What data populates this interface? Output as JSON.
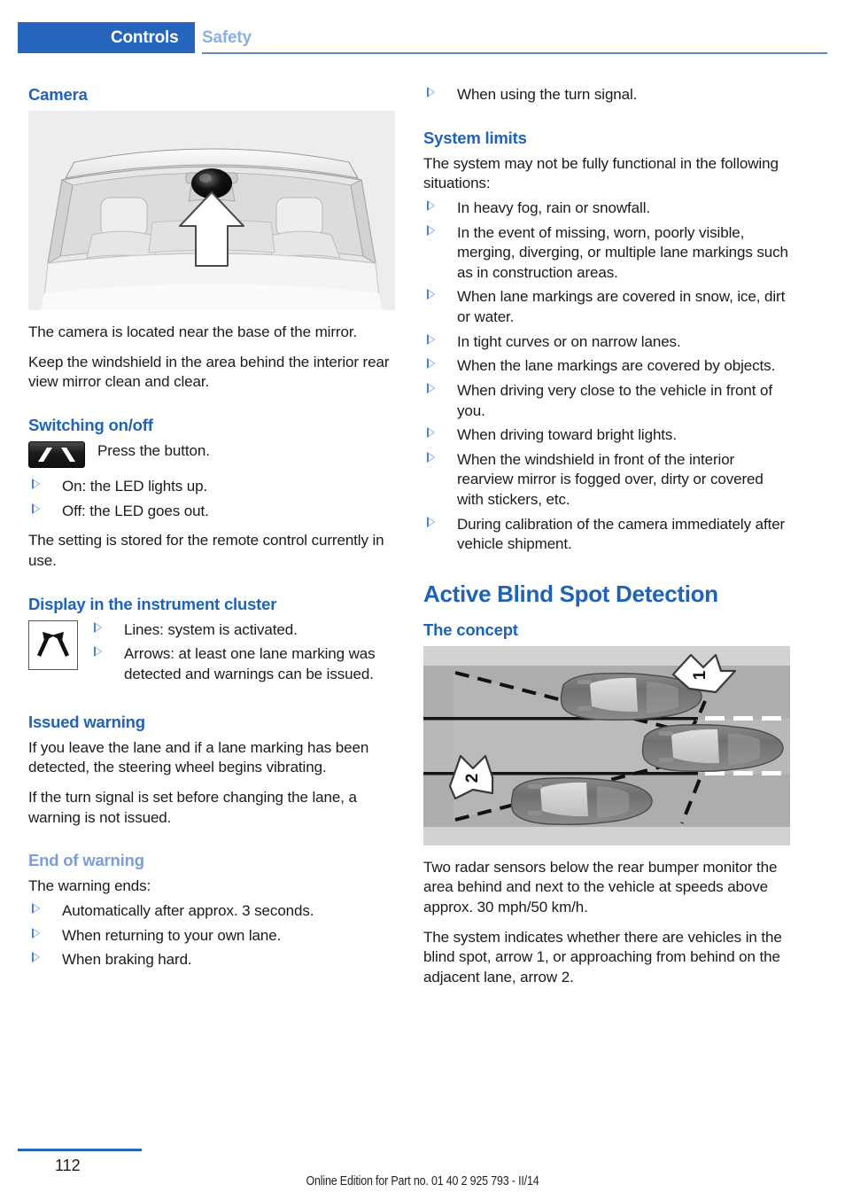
{
  "header": {
    "active_tab": "Controls",
    "inactive_tab": "Safety",
    "accent_color": "#2665BE",
    "inactive_color": "#8FAEE0"
  },
  "left_column": {
    "camera_heading": "Camera",
    "camera_figure_name": "camera-location-illustration",
    "camera_p1": "The camera is located near the base of the mirror.",
    "camera_p2": "Keep the windshield in the area behind the interior rear view mirror clean and clear.",
    "switching_heading": "Switching on/off",
    "switching_icon_text": "Press the button.",
    "switching_bullets": [
      "On: the LED lights up.",
      "Off: the LED goes out."
    ],
    "switching_p1": "The setting is stored for the remote control currently in use.",
    "cluster_heading": "Display in the instrument cluster",
    "cluster_bullets": [
      "Lines: system is activated.",
      "Arrows: at least one lane marking was detected and warnings can be issued."
    ],
    "issued_heading": "Issued warning",
    "issued_p1": "If you leave the lane and if a lane marking has been detected, the steering wheel begins vibrating.",
    "issued_p2": "If the turn signal is set before changing the lane, a warning is not issued.",
    "end_heading": "End of warning",
    "end_p1": "The warning ends:",
    "end_bullets": [
      "Automatically after approx. 3 seconds.",
      "When returning to your own lane.",
      "When braking hard."
    ]
  },
  "right_column": {
    "top_bullet": "When using the turn signal.",
    "limits_heading": "System limits",
    "limits_intro": "The system may not be fully functional in the following situations:",
    "limits_bullets": [
      "In heavy fog, rain or snowfall.",
      "In the event of missing, worn, poorly visible, merging, diverging, or multiple lane markings such as in construction areas.",
      "When lane markings are covered in snow, ice, dirt or water.",
      "In tight curves or on narrow lanes.",
      "When the lane markings are covered by objects.",
      "When driving very close to the vehicle in front of you.",
      "When driving toward bright lights.",
      "When the windshield in front of the interior rearview mirror is fogged over, dirty or covered with stickers, etc.",
      "During calibration of the camera immediately after vehicle shipment."
    ],
    "blind_spot_chapter": "Active Blind Spot Detection",
    "concept_heading": "The concept",
    "blind_figure_name": "blind-spot-detection-diagram",
    "blind_callout_1": "1",
    "blind_callout_2": "2",
    "blind_p1": "Two radar sensors below the rear bumper monitor the area behind and next to the vehicle at speeds above approx. 30 mph/50 km/h.",
    "blind_p2": "The system indicates whether there are vehicles in the blind spot, arrow 1, or approaching from behind on the adjacent lane, arrow 2."
  },
  "footer": {
    "page_number": "112",
    "edition": "Online Edition for Part no. 01 40 2 925 793 - II/14"
  }
}
